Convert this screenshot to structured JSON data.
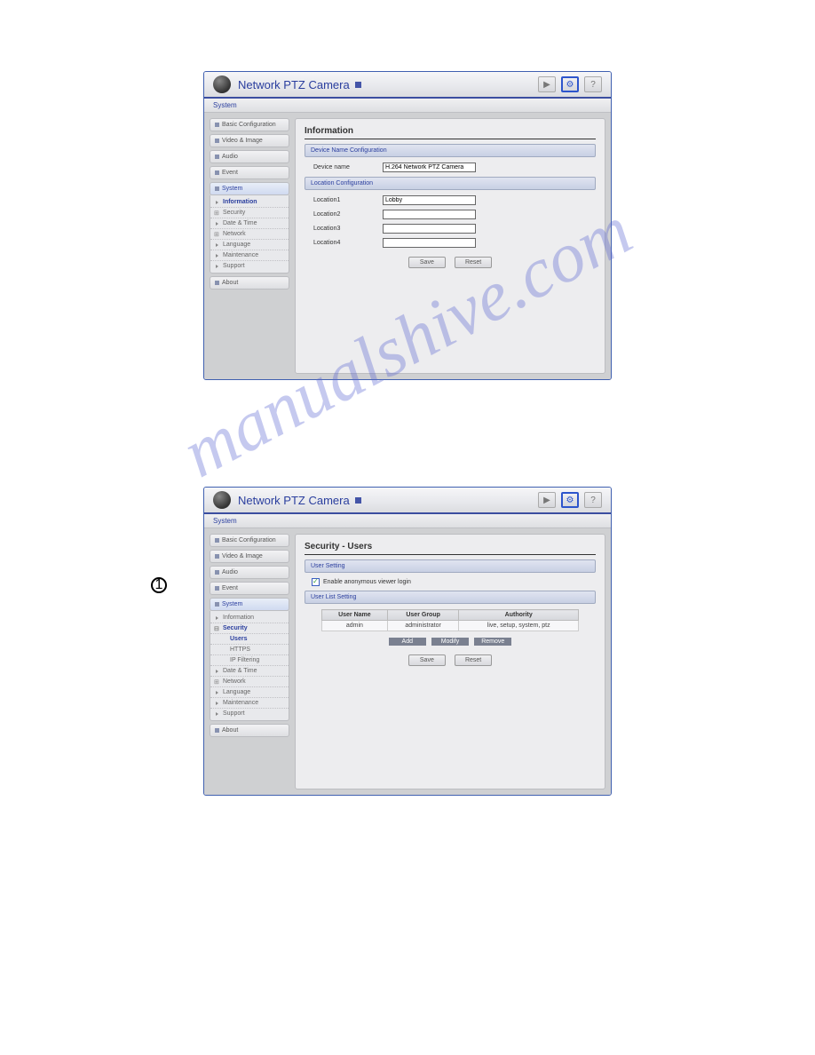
{
  "watermark": "manualshive.com",
  "circled_num": "1",
  "header": {
    "title": "Network PTZ Camera"
  },
  "shot1": {
    "crumb": "System",
    "nav": {
      "basic": "Basic Configuration",
      "video": "Video & Image",
      "audio": "Audio",
      "event": "Event",
      "system": "System",
      "about": "About"
    },
    "subnav": {
      "information": "Information",
      "security": "Security",
      "datetime": "Date & Time",
      "network": "Network",
      "language": "Language",
      "maintenance": "Maintenance",
      "support": "Support"
    },
    "main": {
      "heading": "Information",
      "sect1": "Device Name Configuration",
      "devname_lbl": "Device name",
      "devname_val": "H.264 Network PTZ Camera",
      "sect2": "Location Configuration",
      "loc1_lbl": "Location1",
      "loc1_val": "Lobby",
      "loc2_lbl": "Location2",
      "loc2_val": "",
      "loc3_lbl": "Location3",
      "loc3_val": "",
      "loc4_lbl": "Location4",
      "loc4_val": "",
      "save": "Save",
      "reset": "Reset"
    }
  },
  "shot2": {
    "crumb": "System",
    "nav": {
      "basic": "Basic Configuration",
      "video": "Video & Image",
      "audio": "Audio",
      "event": "Event",
      "system": "System",
      "about": "About"
    },
    "subnav": {
      "information": "Information",
      "security": "Security",
      "users": "Users",
      "https": "HTTPS",
      "ipfilter": "IP Filtering",
      "datetime": "Date & Time",
      "network": "Network",
      "language": "Language",
      "maintenance": "Maintenance",
      "support": "Support"
    },
    "main": {
      "heading": "Security - Users",
      "sect1": "User Setting",
      "chk_label": "Enable anonymous viewer login",
      "sect2": "User List Setting",
      "th": {
        "name": "User Name",
        "group": "User Group",
        "auth": "Authority"
      },
      "row": {
        "name": "admin",
        "group": "administrator",
        "auth": "live, setup, system, ptz"
      },
      "btns": {
        "add": "Add",
        "modify": "Modify",
        "remove": "Remove"
      },
      "save": "Save",
      "reset": "Reset"
    }
  }
}
